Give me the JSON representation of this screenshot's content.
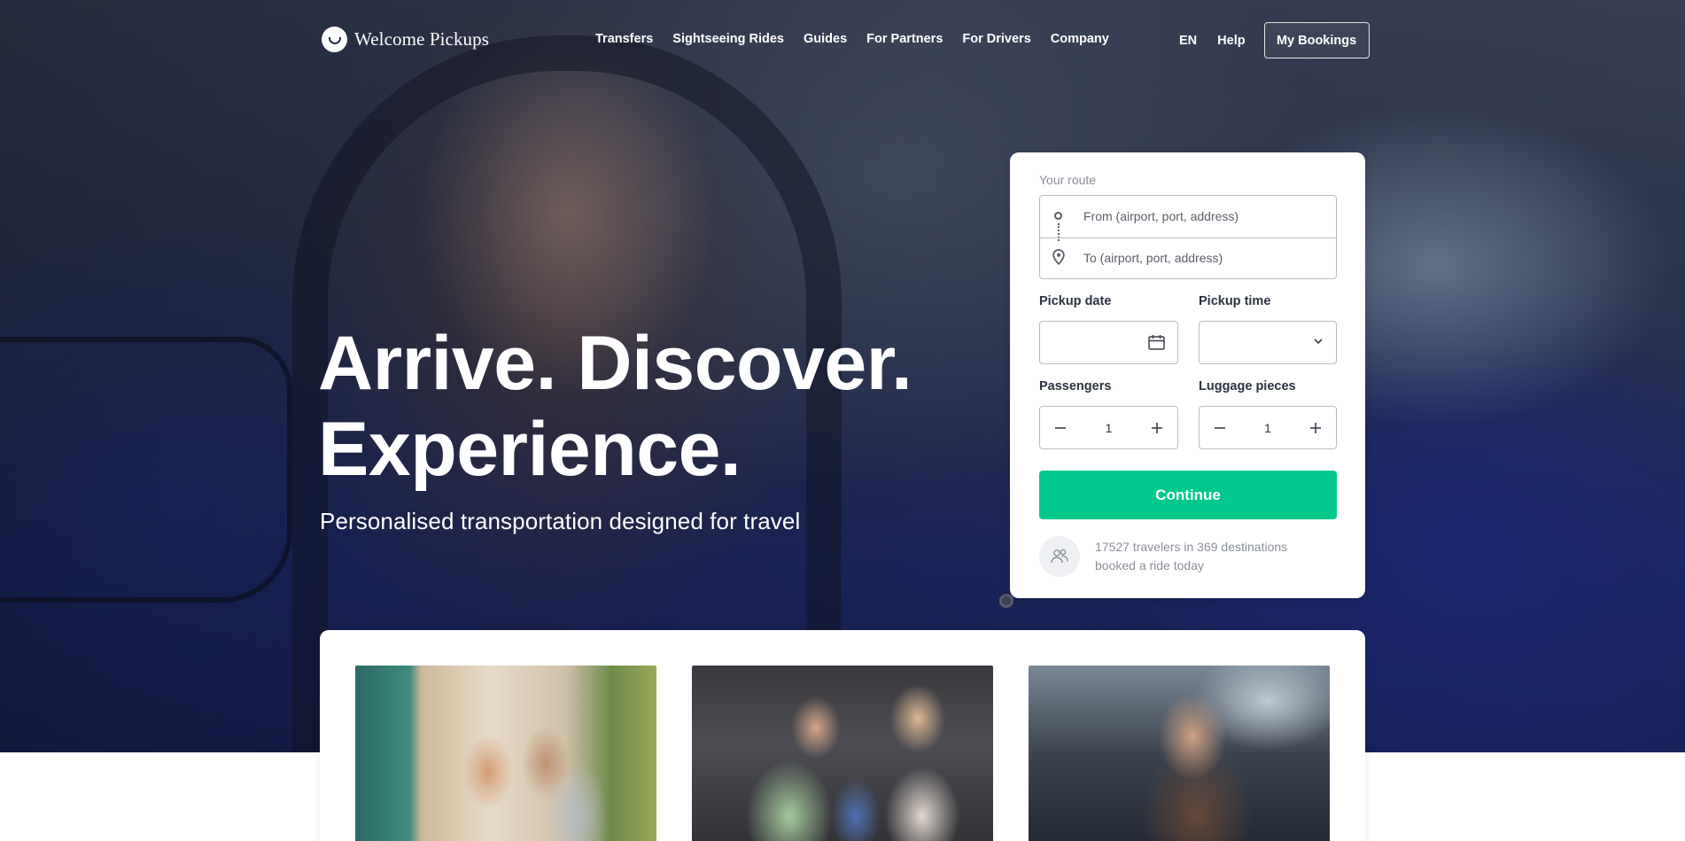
{
  "brand": {
    "name": "Welcome Pickups",
    "logo_icon": "welcome-pickups-logo-icon"
  },
  "nav": {
    "items": [
      {
        "label": "Transfers"
      },
      {
        "label": "Sightseeing Rides"
      },
      {
        "label": "Guides"
      },
      {
        "label": "For Partners"
      },
      {
        "label": "For Drivers"
      },
      {
        "label": "Company"
      }
    ],
    "language": "EN",
    "help": "Help",
    "my_bookings": "My Bookings"
  },
  "hero": {
    "title_line1": "Arrive. Discover.",
    "title_line2": "Experience.",
    "subtitle": "Personalised transportation designed for travel"
  },
  "booking": {
    "route_label": "Your route",
    "from_placeholder": "From (airport, port, address)",
    "to_placeholder": "To (airport, port, address)",
    "pickup_date_label": "Pickup date",
    "pickup_date_value": "",
    "pickup_time_label": "Pickup time",
    "pickup_time_value": "",
    "passengers_label": "Passengers",
    "passengers_value": "1",
    "luggage_label": "Luggage pieces",
    "luggage_value": "1",
    "continue_label": "Continue",
    "travelers_text": "17527 travelers in 369 destinations booked a ride today"
  },
  "colors": {
    "accent": "#02c88e",
    "hero_navy": "#1c2660",
    "text_dark": "#2d3240",
    "text_muted": "#8a8f9a"
  },
  "icons": [
    "origin-dot-icon",
    "location-pin-icon",
    "calendar-icon",
    "chevron-down-icon",
    "minus-icon",
    "plus-icon",
    "travelers-icon"
  ]
}
